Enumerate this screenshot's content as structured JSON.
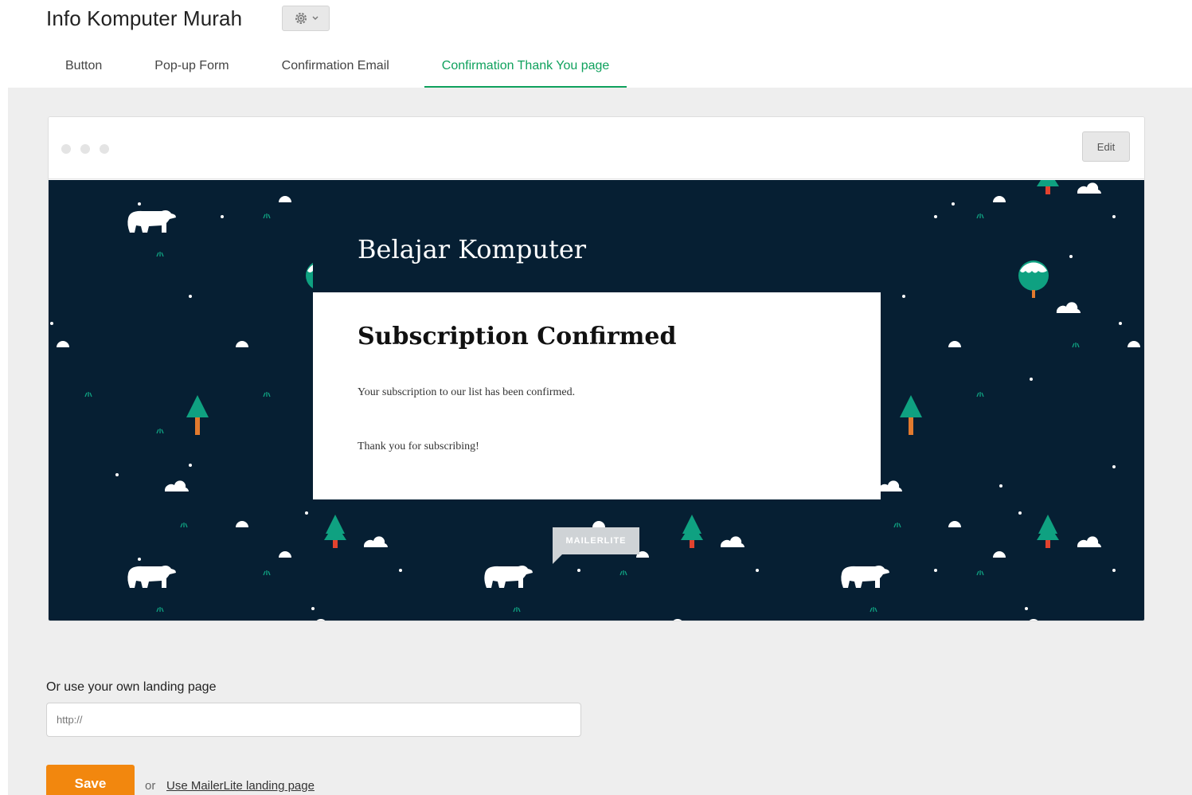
{
  "header": {
    "title": "Info Komputer Murah",
    "settings_icon": "gear-icon",
    "settings_caret_icon": "caret-down-icon"
  },
  "tabs": [
    {
      "label": "Button",
      "active": false
    },
    {
      "label": "Pop-up Form",
      "active": false
    },
    {
      "label": "Confirmation Email",
      "active": false
    },
    {
      "label": "Confirmation Thank You page",
      "active": true
    }
  ],
  "preview": {
    "edit_label": "Edit",
    "brand_name": "Belajar Komputer",
    "card_title": "Subscription Confirmed",
    "card_text1": "Your subscription to our list has been confirmed.",
    "card_text2": "Thank you for subscribing!",
    "badge": "MAILERLITE"
  },
  "landing": {
    "label": "Or use your own landing page",
    "placeholder": "http://",
    "save_label": "Save",
    "or_text": "or",
    "link_label": "Use MailerLite landing page"
  },
  "colors": {
    "accent": "#0fa15d",
    "save": "#f2870e",
    "canvas_bg": "#061f33"
  }
}
